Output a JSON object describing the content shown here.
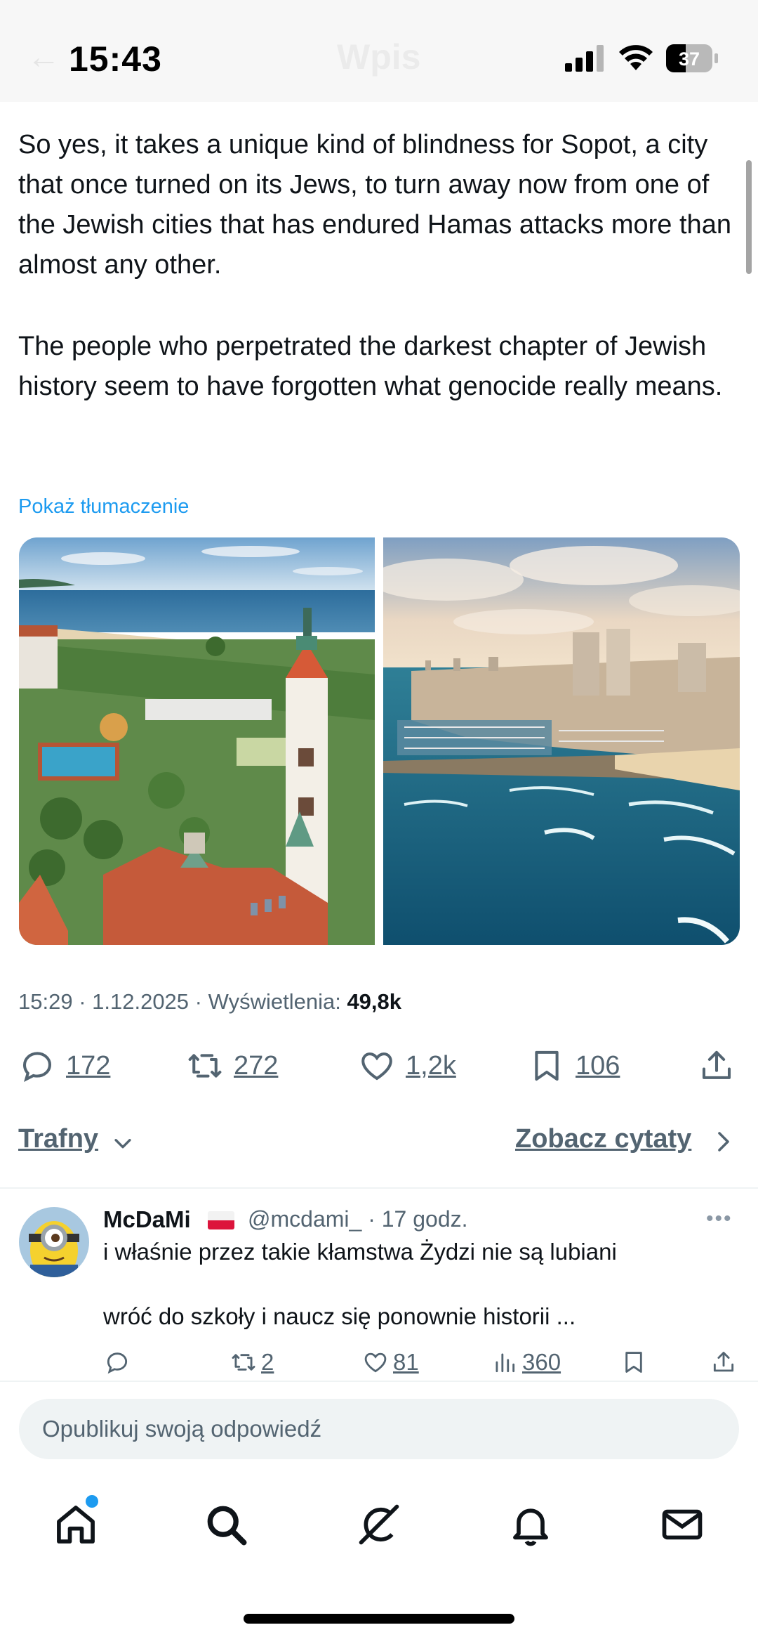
{
  "status_bar": {
    "time": "15:43",
    "battery_level": "37",
    "ghost_title": "Wpis",
    "back_glyph": "←"
  },
  "tweet": {
    "paragraphs": [
      "So yes, it takes a unique kind of blindness for Sopot, a city that once turned on its Jews, to turn away now from one of the Jewish cities that has endured Hamas attacks more than almost any other.",
      "The people who perpetrated the darkest chapter of Jewish history seem to have forgotten what genocide really means."
    ],
    "translate_link": "Pokaż tłumaczenie",
    "media": [
      {
        "alt": "sopot-aerial-photo"
      },
      {
        "alt": "coastal-marina-city-photo"
      }
    ],
    "meta_prefix": "15:29 · 1.12.2025 · Wyświetlenia:",
    "views": "49,8k",
    "actions": {
      "replies": "172",
      "reposts": "272",
      "likes": "1,2k",
      "bookmarks": "106"
    }
  },
  "replies_header": {
    "sort_label": "Trafny",
    "quotes_link": "Zobacz cytaty"
  },
  "reply": {
    "name": "McDaMi",
    "handle_time": "@mcdami_ · 17 godz.",
    "more": "•••",
    "text_line1": "i właśnie przez takie kłamstwa Żydzi nie są lubiani",
    "text_line2": "wróć do szkoły i naucz się ponownie historii ...",
    "reposts": "2",
    "likes": "81",
    "views": "360"
  },
  "composer": {
    "placeholder": "Opublikuj swoją odpowiedź"
  },
  "icons": {
    "tabs": [
      "home-icon",
      "search-icon",
      "grok-icon",
      "bell-icon",
      "mail-icon"
    ]
  },
  "colors": {
    "accent": "#1d9bf0",
    "secondary_text": "#536471",
    "primary_text": "#0f1419"
  }
}
